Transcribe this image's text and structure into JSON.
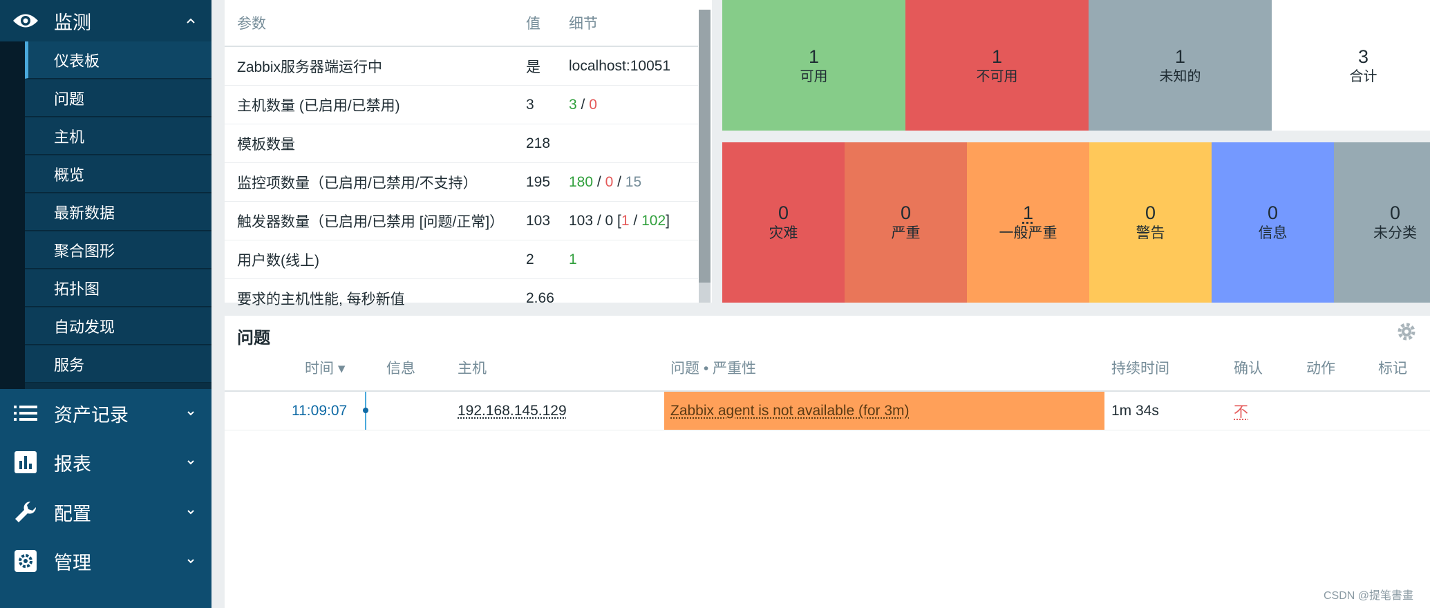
{
  "sidebar": {
    "monitor": {
      "label": "监测",
      "icon": "eye-icon"
    },
    "items": [
      {
        "label": "仪表板",
        "active": true
      },
      {
        "label": "问题"
      },
      {
        "label": "主机"
      },
      {
        "label": "概览"
      },
      {
        "label": "最新数据"
      },
      {
        "label": "聚合图形"
      },
      {
        "label": "拓扑图"
      },
      {
        "label": "自动发现"
      },
      {
        "label": "服务"
      }
    ],
    "sections": [
      {
        "label": "资产记录",
        "icon": "list-icon"
      },
      {
        "label": "报表",
        "icon": "bar-chart-icon"
      },
      {
        "label": "配置",
        "icon": "wrench-icon"
      },
      {
        "label": "管理",
        "icon": "gear-icon"
      }
    ]
  },
  "system_info": {
    "headers": {
      "param": "参数",
      "value": "值",
      "details": "细节"
    },
    "rows": [
      {
        "param": "Zabbix服务器端运行中",
        "value": "是",
        "details": "localhost:10051"
      },
      {
        "param": "主机数量 (已启用/已禁用)",
        "value": "3",
        "d1": "3",
        "s1": " / ",
        "d2": "0"
      },
      {
        "param": "模板数量",
        "value": "218"
      },
      {
        "param": "监控项数量（已启用/已禁用/不支持）",
        "value": "195",
        "d1": "180",
        "s1": " / ",
        "d2": "0",
        "s2": " / ",
        "d3": "15"
      },
      {
        "param": "触发器数量（已启用/已禁用 [问题/正常]）",
        "value": "103",
        "pre": "103 / 0 [",
        "d1": "1",
        "s1": " / ",
        "d2": "102",
        "post": "]"
      },
      {
        "param": "用户数(线上)",
        "value": "2",
        "d1": "1"
      },
      {
        "param": "要求的主机性能, 每秒新值",
        "value": "2.66"
      }
    ]
  },
  "host_availability": [
    {
      "count": "1",
      "label": "可用",
      "color": "#86cc89"
    },
    {
      "count": "1",
      "label": "不可用",
      "color": "#e45959"
    },
    {
      "count": "1",
      "label": "未知的",
      "color": "#97aab3"
    },
    {
      "count": "3",
      "label": "合计",
      "color": "#ffffff"
    }
  ],
  "severity": [
    {
      "count": "0",
      "label": "灾难",
      "color": "#e45959"
    },
    {
      "count": "0",
      "label": "严重",
      "color": "#e97659"
    },
    {
      "count": "1",
      "label": "一般严重",
      "color": "#ffa059"
    },
    {
      "count": "0",
      "label": "警告",
      "color": "#ffc859"
    },
    {
      "count": "0",
      "label": "信息",
      "color": "#7499ff"
    },
    {
      "count": "0",
      "label": "未分类",
      "color": "#97aab3"
    }
  ],
  "problems": {
    "title": "问题",
    "headers": {
      "time": "时间 ▾",
      "info": "信息",
      "host": "主机",
      "problem": "问题 • 严重性",
      "duration": "持续时间",
      "ack": "确认",
      "actions": "动作",
      "tags": "标记"
    },
    "row": {
      "time": "11:09:07",
      "host": "192.168.145.129",
      "problem": "Zabbix agent is not available (for 3m)",
      "duration": "1m 34s",
      "ack": "不"
    }
  },
  "watermark": "CSDN @提笔書畫"
}
